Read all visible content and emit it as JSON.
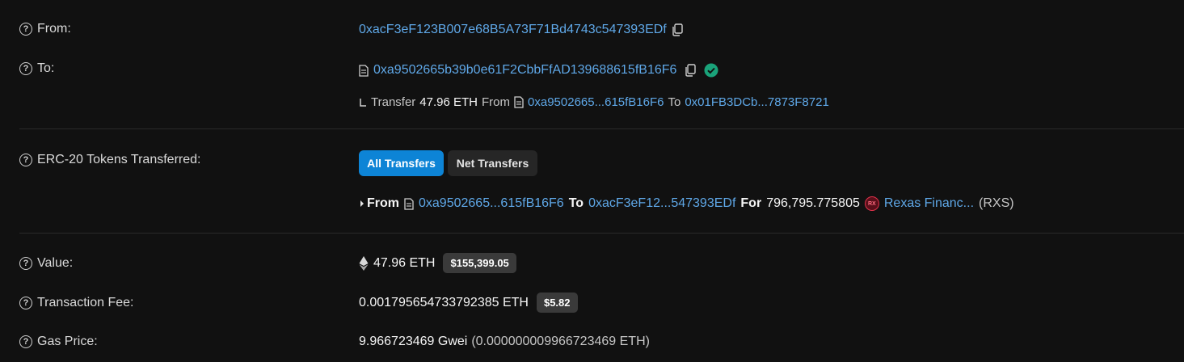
{
  "from": {
    "label": "From:",
    "address": "0xacF3eF123B007e68B5A73F71Bd4743c547393EDf"
  },
  "to": {
    "label": "To:",
    "address": "0xa9502665b39b0e61F2CbbFfAD139688615fB16F6",
    "internal": {
      "transfer_word": "Transfer",
      "amount": "47.96 ETH",
      "from_word": "From",
      "from_address": "0xa9502665...615fB16F6",
      "to_word": "To",
      "to_address": "0x01FB3DCb...7873F8721"
    }
  },
  "erc20": {
    "label": "ERC-20 Tokens Transferred:",
    "tabs": {
      "all": "All Transfers",
      "net": "Net Transfers"
    },
    "transfer": {
      "from_word": "From",
      "from_address": "0xa9502665...615fB16F6",
      "to_word": "To",
      "to_address": "0xacF3eF12...547393EDf",
      "for_word": "For",
      "amount": "796,795.775805",
      "token_name": "Rexas Financ...",
      "token_symbol": "(RXS)"
    }
  },
  "value": {
    "label": "Value:",
    "amount": "47.96 ETH",
    "usd": "$155,399.05"
  },
  "fee": {
    "label": "Transaction Fee:",
    "amount": "0.001795654733792385 ETH",
    "usd": "$5.82"
  },
  "gas": {
    "label": "Gas Price:",
    "gwei": "9.966723469 Gwei",
    "eth": "(0.000000009966723469 ETH)"
  },
  "colors": {
    "background": "#111111",
    "link": "#5fa8e8",
    "primary_button": "#0d84d6",
    "verified": "#1aa37a"
  }
}
